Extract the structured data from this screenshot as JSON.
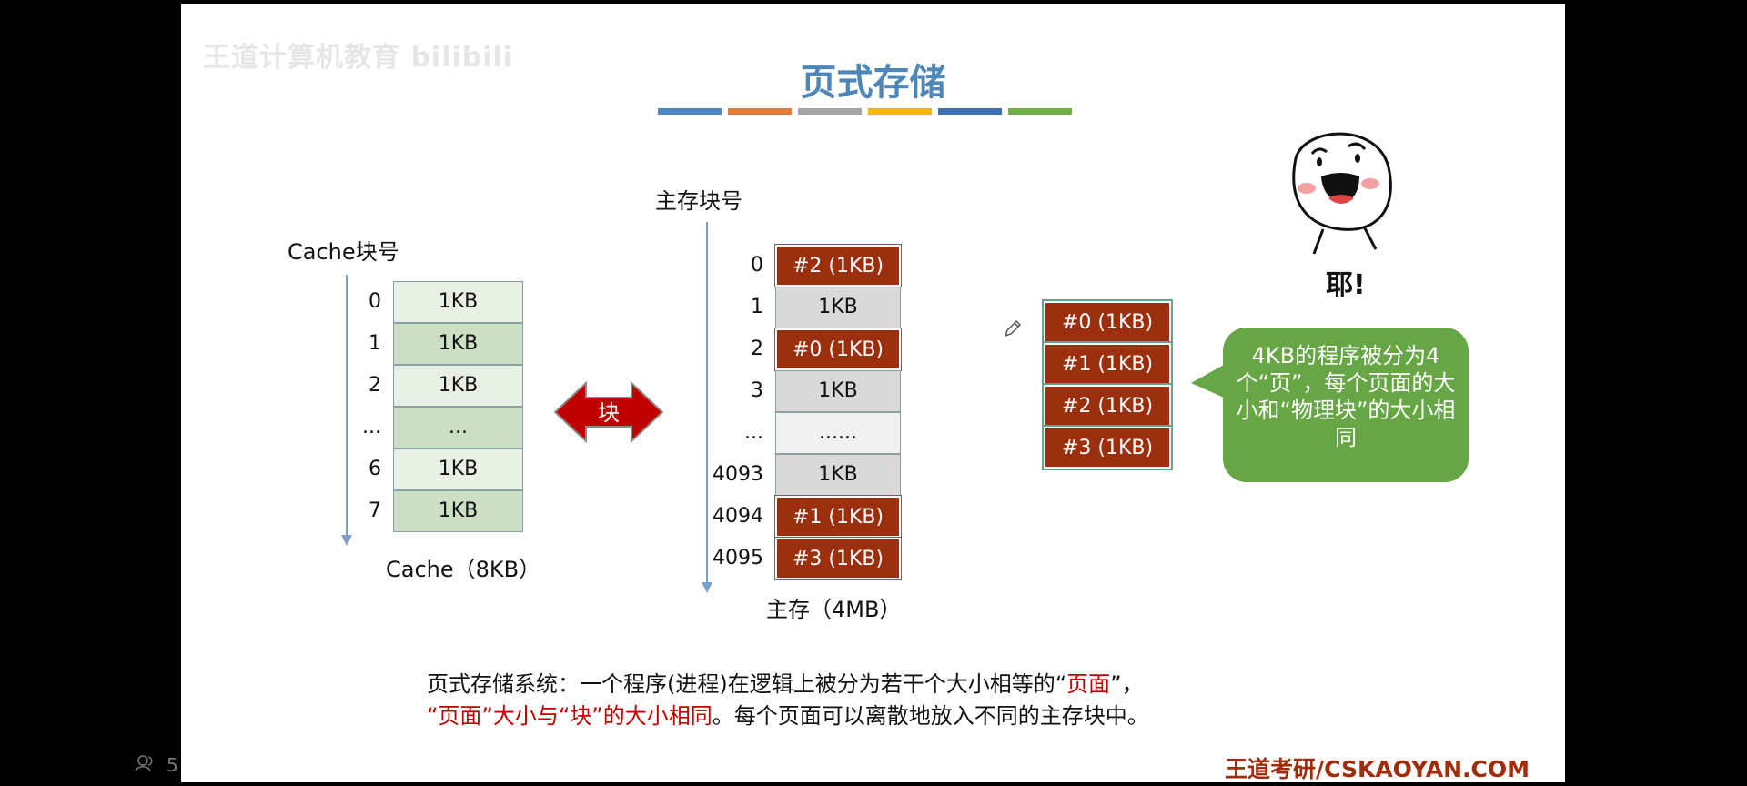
{
  "watermark": "王道计算机教育 bilibili",
  "title": "页式存储",
  "title_bars": [
    "#4f86c6",
    "#e07b39",
    "#a5a5a5",
    "#f2b800",
    "#3d6fb4",
    "#70ad47"
  ],
  "cache": {
    "header": "Cache块号",
    "rows": [
      {
        "num": "0",
        "val": "1KB"
      },
      {
        "num": "1",
        "val": "1KB"
      },
      {
        "num": "2",
        "val": "1KB"
      },
      {
        "num": "...",
        "val": "..."
      },
      {
        "num": "6",
        "val": "1KB"
      },
      {
        "num": "7",
        "val": "1KB"
      }
    ],
    "caption": "Cache（8KB）"
  },
  "arrow_label": "块",
  "memory": {
    "header": "主存块号",
    "rows": [
      {
        "num": "0",
        "val": "#2 (1KB)"
      },
      {
        "num": "1",
        "val": "1KB"
      },
      {
        "num": "2",
        "val": "#0 (1KB)"
      },
      {
        "num": "3",
        "val": "1KB"
      },
      {
        "num": "...",
        "val": "......"
      },
      {
        "num": "4093",
        "val": "1KB"
      },
      {
        "num": "4094",
        "val": "#1 (1KB)"
      },
      {
        "num": "4095",
        "val": "#3 (1KB)"
      }
    ],
    "caption": "主存（4MB）"
  },
  "pages": [
    "#0 (1KB)",
    "#1 (1KB)",
    "#2 (1KB)",
    "#3 (1KB)"
  ],
  "bubble_text": "4KB的程序被分为4个“页”，每个页面的大小和“物理块”的大小相同",
  "mascot_text": "耶!",
  "bottom": {
    "line1_a": "页式存储系统：一个程序(进程)在逻辑上被分为若干个大小相等的“",
    "line1_hl": "页面",
    "line1_b": "”，",
    "line2_hl": "“页面”大小与“块”的大小相同",
    "line2_b": "。每个页面可以离散地放入不同的主存块中。"
  },
  "footer": "王道考研/CSKAOYAN.COM",
  "viewer_count": "5"
}
